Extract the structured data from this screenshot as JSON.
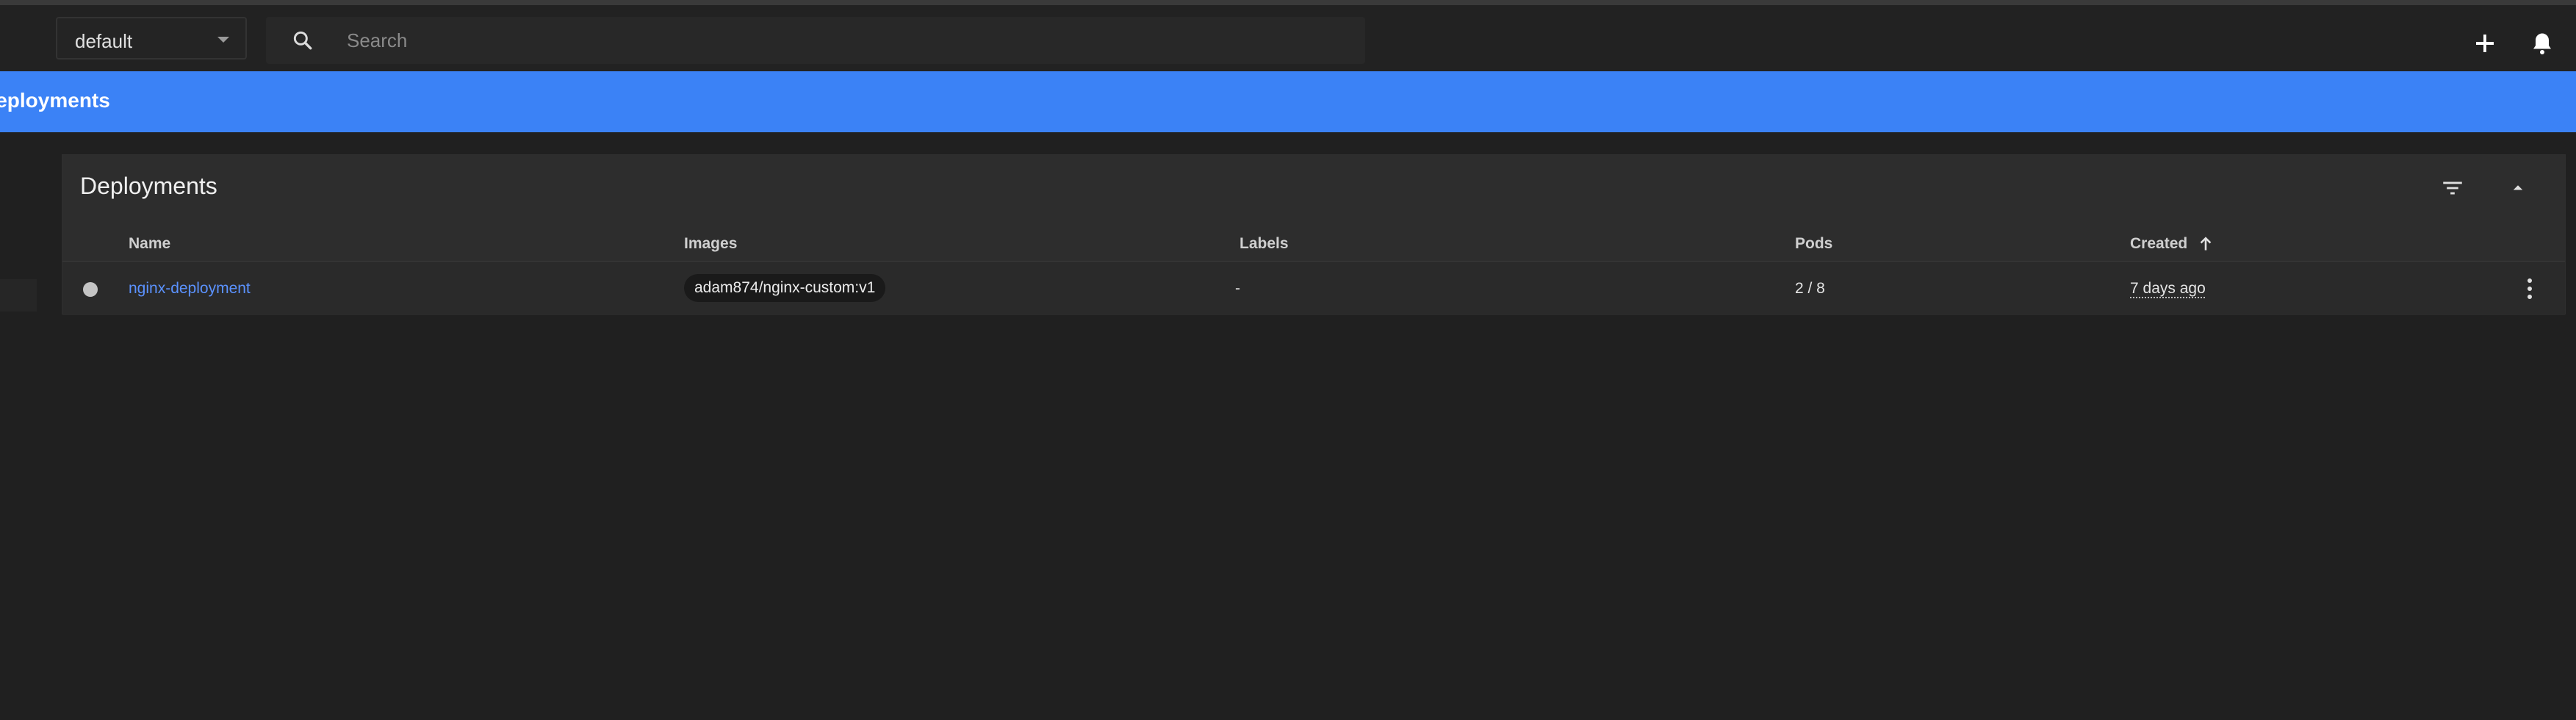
{
  "toolbar": {
    "namespace": "default",
    "search_placeholder": "Search",
    "icons": [
      "search-icon",
      "add-icon",
      "bell-icon"
    ]
  },
  "banner": {
    "title": "Deployments"
  },
  "card": {
    "title": "Deployments",
    "header_icons": [
      "filter-icon",
      "collapse-icon"
    ],
    "columns": {
      "name": "Name",
      "images": "Images",
      "labels": "Labels",
      "pods": "Pods",
      "created": "Created"
    },
    "sort": {
      "column": "created",
      "direction": "ascending"
    },
    "rows": [
      {
        "name": "nginx-deployment",
        "image": "adam874/nginx-custom:v1",
        "labels": "-",
        "pods": "2 / 8",
        "created": "7 days ago"
      }
    ]
  },
  "colors": {
    "accent": "#3b82f6",
    "link": "#5b92ff",
    "background": "#202020",
    "card": "#2b2b2b",
    "status_dot": "#c4c4c4"
  }
}
